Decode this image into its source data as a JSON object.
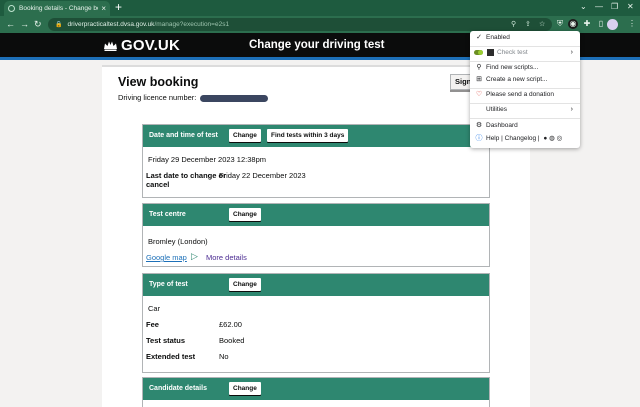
{
  "browser": {
    "tab_title": "Booking details - Change booking",
    "new_tab": "+",
    "url_host": "driverpracticaltest.dvsa.gov.uk",
    "url_path": "/manage?execution=e2s1"
  },
  "header": {
    "logo_text": "GOV.UK",
    "service_name": "Change your driving test"
  },
  "page": {
    "title": "View booking",
    "licence_label": "Driving licence number:",
    "sign_out": "Sign out"
  },
  "date_section": {
    "heading": "Date and time of test",
    "change": "Change",
    "find_tests": "Find tests within 3 days",
    "datetime": "Friday 29 December 2023 12:38pm",
    "last_date_label_1": "Last date to change or",
    "last_date_label_2": "cancel",
    "last_date_value": "Friday 22 December 2023"
  },
  "centre_section": {
    "heading": "Test centre",
    "change": "Change",
    "centre": "Bromley (London)",
    "map_link": "Google map",
    "more_details": "More details"
  },
  "type_section": {
    "heading": "Type of test",
    "change": "Change",
    "type": "Car",
    "fee_label": "Fee",
    "fee_value": "£62.00",
    "status_label": "Test status",
    "status_value": "Booked",
    "extended_label": "Extended test",
    "extended_value": "No"
  },
  "candidate_section": {
    "heading": "Candidate details",
    "change": "Change"
  },
  "ext_menu": {
    "enabled": "Enabled",
    "check_test": "Check test",
    "find_scripts": "Find new scripts...",
    "create_script": "Create a new script...",
    "donation": "Please send a donation",
    "utilities": "Utilities",
    "dashboard": "Dashboard",
    "help": "Help | Changelog |"
  }
}
